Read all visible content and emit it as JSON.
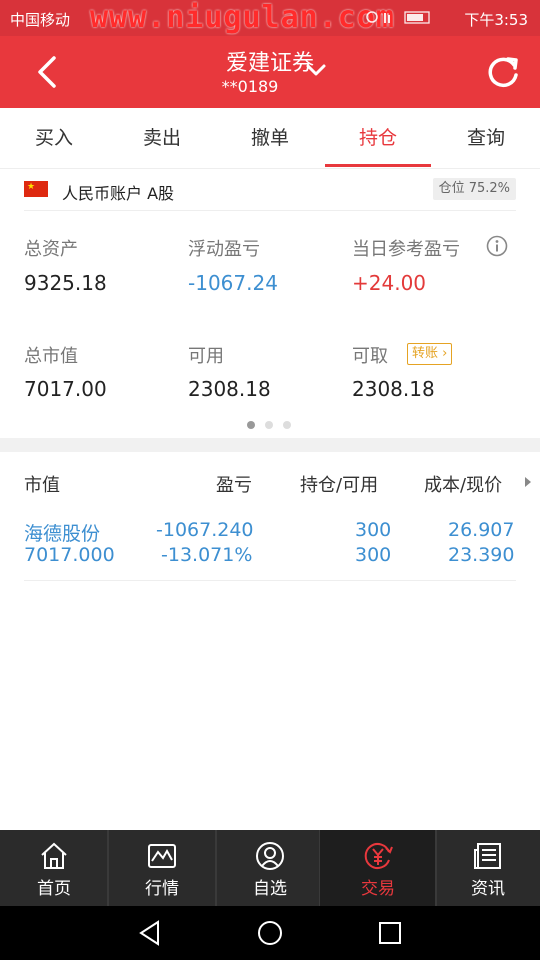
{
  "status_bar": {
    "carrier": "中国移动",
    "watermark": "www.niugulan.com",
    "time": "下午3:53"
  },
  "header": {
    "title": "爱建证券",
    "account": "**0189",
    "back_icon": "chevron-left-icon",
    "dropdown_icon": "chevron-down-icon",
    "refresh_icon": "refresh-icon"
  },
  "tabs": [
    {
      "label": "买入",
      "active": false
    },
    {
      "label": "卖出",
      "active": false
    },
    {
      "label": "撤单",
      "active": false
    },
    {
      "label": "持仓",
      "active": true
    },
    {
      "label": "查询",
      "active": false
    }
  ],
  "account_row": {
    "label": "人民币账户 A股",
    "position_badge": "仓位 75.2%"
  },
  "summary": {
    "total_assets": {
      "label": "总资产",
      "value": "9325.18"
    },
    "floating_pnl": {
      "label": "浮动盈亏",
      "value": "-1067.24"
    },
    "daily_pnl": {
      "label": "当日参考盈亏",
      "value": "+24.00"
    },
    "market_value": {
      "label": "总市值",
      "value": "7017.00"
    },
    "available": {
      "label": "可用",
      "value": "2308.18"
    },
    "withdrawable": {
      "label": "可取",
      "value": "2308.18"
    },
    "transfer_label": "转账",
    "page_index": 0,
    "page_count": 3
  },
  "holdings": {
    "headers": [
      "市值",
      "盈亏",
      "持仓/可用",
      "成本/现价"
    ],
    "rows": [
      {
        "name": "海德股份",
        "market_value": "7017.000",
        "pnl": "-1067.240",
        "pnl_pct": "-13.071%",
        "position": "300",
        "available": "300",
        "cost": "26.907",
        "price": "23.390"
      }
    ]
  },
  "bottom_nav": [
    {
      "label": "首页",
      "icon": "home-icon",
      "active": false
    },
    {
      "label": "行情",
      "icon": "chart-icon",
      "active": false
    },
    {
      "label": "自选",
      "icon": "user-icon",
      "active": false
    },
    {
      "label": "交易",
      "icon": "yuan-icon",
      "active": true
    },
    {
      "label": "资讯",
      "icon": "news-icon",
      "active": false
    }
  ],
  "colors": {
    "brand_red": "#e8383d",
    "gain_red": "#e33a3a",
    "loss_blue": "#3d8fd1",
    "warning_orange": "#e5a323"
  }
}
